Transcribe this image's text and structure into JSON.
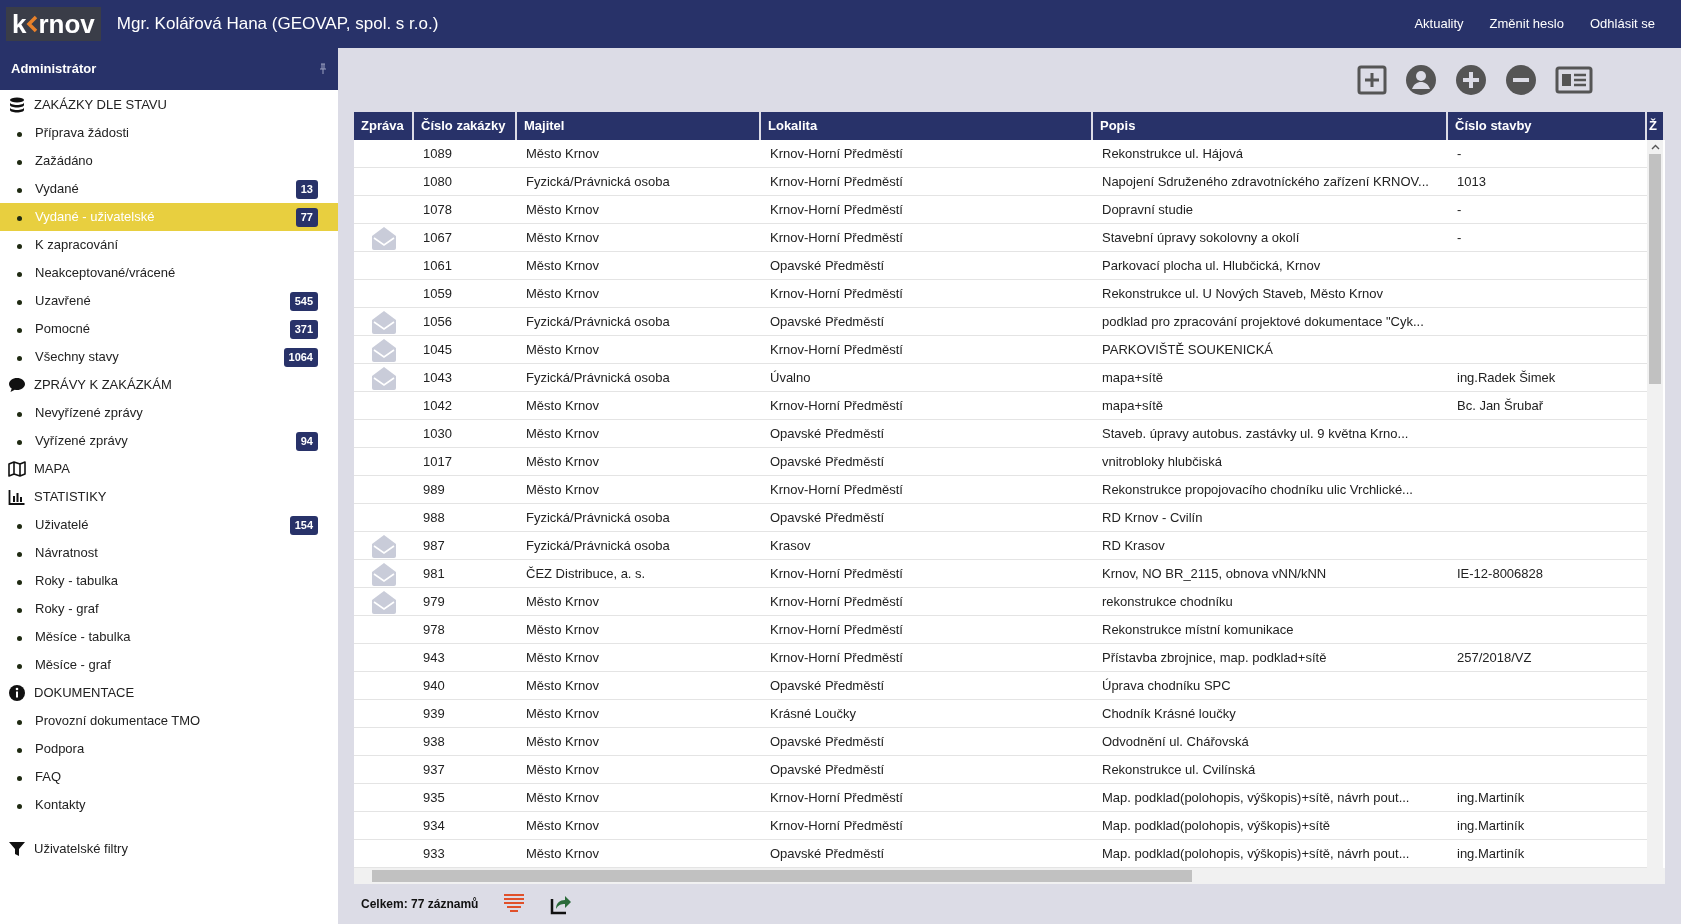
{
  "header": {
    "logo": [
      "k",
      "rnov"
    ],
    "user": "Mgr. Kolářová Hana (GEOVAP, spol. s r.o.)",
    "links": [
      "Aktuality",
      "Změnit heslo",
      "Odhlásit se"
    ]
  },
  "sidebar": {
    "title": "Administrátor",
    "sections": [
      {
        "kind": "database",
        "label": "ZAKÁZKY DLE STAVU",
        "items": [
          {
            "label": "Příprava žádosti",
            "selected": false
          },
          {
            "label": "Zažádáno",
            "selected": false
          },
          {
            "label": "Vydané",
            "badge": "13",
            "selected": false
          },
          {
            "label": "Vydané - uživatelské",
            "badge": "77",
            "selected": true
          },
          {
            "label": "K zapracování",
            "selected": false
          },
          {
            "label": "Neakceptované/vrácené",
            "selected": false
          },
          {
            "label": "Uzavřené",
            "badge": "545",
            "selected": false
          },
          {
            "label": "Pomocné",
            "badge": "371",
            "selected": false
          },
          {
            "label": "Všechny stavy",
            "badge": "1064",
            "selected": false
          }
        ]
      },
      {
        "kind": "chat",
        "label": "ZPRÁVY K ZAKÁZKÁM",
        "items": [
          {
            "label": "Nevyřízené zprávy",
            "selected": false
          },
          {
            "label": "Vyřízené zprávy",
            "badge": "94",
            "selected": false
          }
        ]
      },
      {
        "kind": "map",
        "label": "MAPA"
      },
      {
        "kind": "stats",
        "label": "STATISTIKY",
        "items": [
          {
            "label": "Uživatelé",
            "badge": "154",
            "selected": false
          },
          {
            "label": "Návratnost",
            "selected": false
          },
          {
            "label": "Roky - tabulka",
            "selected": false
          },
          {
            "label": "Roky - graf",
            "selected": false
          },
          {
            "label": "Měsíce - tabulka",
            "selected": false
          },
          {
            "label": "Měsíce - graf",
            "selected": false
          }
        ]
      },
      {
        "kind": "info",
        "label": "DOKUMENTACE",
        "items": [
          {
            "label": "Provozní dokumentace TMO",
            "selected": false
          },
          {
            "label": "Podpora",
            "selected": false
          },
          {
            "label": "FAQ",
            "selected": false
          },
          {
            "label": "Kontakty",
            "selected": false
          }
        ]
      }
    ],
    "filters": "Uživatelské filtry"
  },
  "table": {
    "columns": [
      "Zpráva",
      "Číslo zakázky",
      "Majitel",
      "Lokalita",
      "Popis",
      "Číslo stavby",
      "Ž"
    ],
    "rows": [
      {
        "message": false,
        "number": "1089",
        "owner": "Město Krnov",
        "locality": "Krnov-Horní Předměstí",
        "description": "Rekonstrukce ul. Hájová",
        "building": "-"
      },
      {
        "message": false,
        "number": "1080",
        "owner": "Fyzická/Právnická osoba",
        "locality": "Krnov-Horní Předměstí",
        "description": "Napojení Sdruženého zdravotníckého zařízení KRNOV...",
        "building": "1013"
      },
      {
        "message": false,
        "number": "1078",
        "owner": "Město Krnov",
        "locality": "Krnov-Horní Předměstí",
        "description": "Dopravní studie",
        "building": "-"
      },
      {
        "message": true,
        "number": "1067",
        "owner": "Město Krnov",
        "locality": "Krnov-Horní Předměstí",
        "description": "Stavební úpravy sokolovny a okolí",
        "building": "-"
      },
      {
        "message": false,
        "number": "1061",
        "owner": "Město Krnov",
        "locality": "Opavské Předměstí",
        "description": "Parkovací plocha ul. Hlubčická, Krnov"
      },
      {
        "message": false,
        "number": "1059",
        "owner": "Město Krnov",
        "locality": "Krnov-Horní Předměstí",
        "description": "Rekonstrukce ul. U Nových Staveb, Město Krnov"
      },
      {
        "message": true,
        "number": "1056",
        "owner": "Fyzická/Právnická osoba",
        "locality": "Opavské Předměstí",
        "description": "podklad pro zpracování projektové dokumentace \"Cyk..."
      },
      {
        "message": true,
        "number": "1045",
        "owner": "Město Krnov",
        "locality": "Krnov-Horní Předměstí",
        "description": "PARKOVIŠTĚ SOUKENICKÁ"
      },
      {
        "message": true,
        "number": "1043",
        "owner": "Fyzická/Právnická osoba",
        "locality": "Úvalno",
        "description": "mapa+sítě",
        "building": "ing.Radek Šimek"
      },
      {
        "message": false,
        "number": "1042",
        "owner": "Město Krnov",
        "locality": "Krnov-Horní Předměstí",
        "description": "mapa+sítě",
        "building": "Bc. Jan Šrubař"
      },
      {
        "message": false,
        "number": "1030",
        "owner": "Město Krnov",
        "locality": "Opavské Předměstí",
        "description": "Staveb. úpravy autobus. zastávky ul. 9 května Krno..."
      },
      {
        "message": false,
        "number": "1017",
        "owner": "Město Krnov",
        "locality": "Opavské Předměstí",
        "description": "vnitrobloky hlubčiská"
      },
      {
        "message": false,
        "number": "989",
        "owner": "Město Krnov",
        "locality": "Krnov-Horní Předměstí",
        "description": "Rekonstrukce propojovacího chodníku ulic Vrchlické..."
      },
      {
        "message": false,
        "number": "988",
        "owner": "Fyzická/Právnická osoba",
        "locality": "Opavské Předměstí",
        "description": "RD Krnov - Cvilín"
      },
      {
        "message": true,
        "number": "987",
        "owner": "Fyzická/Právnická osoba",
        "locality": "Krasov",
        "description": "RD Krasov"
      },
      {
        "message": true,
        "number": "981",
        "owner": "ČEZ Distribuce, a. s.",
        "locality": "Krnov-Horní Předměstí",
        "description": "Krnov, NO BR_2115, obnova  vNN/kNN",
        "building": "IE-12-8006828"
      },
      {
        "message": true,
        "number": "979",
        "owner": "Město Krnov",
        "locality": "Krnov-Horní Předměstí",
        "description": "rekonstrukce chodníku"
      },
      {
        "message": false,
        "number": "978",
        "owner": "Město Krnov",
        "locality": "Krnov-Horní Předměstí",
        "description": "Rekonstrukce místní komunikace"
      },
      {
        "message": false,
        "number": "943",
        "owner": "Město Krnov",
        "locality": "Krnov-Horní Předměstí",
        "description": "Přístavba zbrojnice, map. podklad+sítě",
        "building": "257/2018/VZ"
      },
      {
        "message": false,
        "number": "940",
        "owner": "Město Krnov",
        "locality": "Opavské Předměstí",
        "description": "Úprava chodníku SPC"
      },
      {
        "message": false,
        "number": "939",
        "owner": "Město Krnov",
        "locality": "Krásné Loučky",
        "description": "Chodník Krásné loučky"
      },
      {
        "message": false,
        "number": "938",
        "owner": "Město Krnov",
        "locality": "Opavské Předměstí",
        "description": "Odvodnění ul. Chářovská"
      },
      {
        "message": false,
        "number": "937",
        "owner": "Město Krnov",
        "locality": "Opavské Předměstí",
        "description": "Rekonstrukce ul. Cvilínská"
      },
      {
        "message": false,
        "number": "935",
        "owner": "Město Krnov",
        "locality": "Krnov-Horní Předměstí",
        "description": "Map. podklad(polohopis, výškopis)+sítě, návrh pout...",
        "building": "ing.Martiník"
      },
      {
        "message": false,
        "number": "934",
        "owner": "Město Krnov",
        "locality": "Krnov-Horní Předměstí",
        "description": "Map. podklad(polohopis, výškopis)+sítě",
        "building": "ing.Martiník"
      },
      {
        "message": false,
        "number": "933",
        "owner": "Město Krnov",
        "locality": "Opavské Předměstí",
        "description": "Map. podklad(polohopis, výškopis)+sítě, návrh pout...",
        "building": "ing.Martiník"
      }
    ]
  },
  "footer": {
    "total": "Celkem: 77 záznamů"
  }
}
